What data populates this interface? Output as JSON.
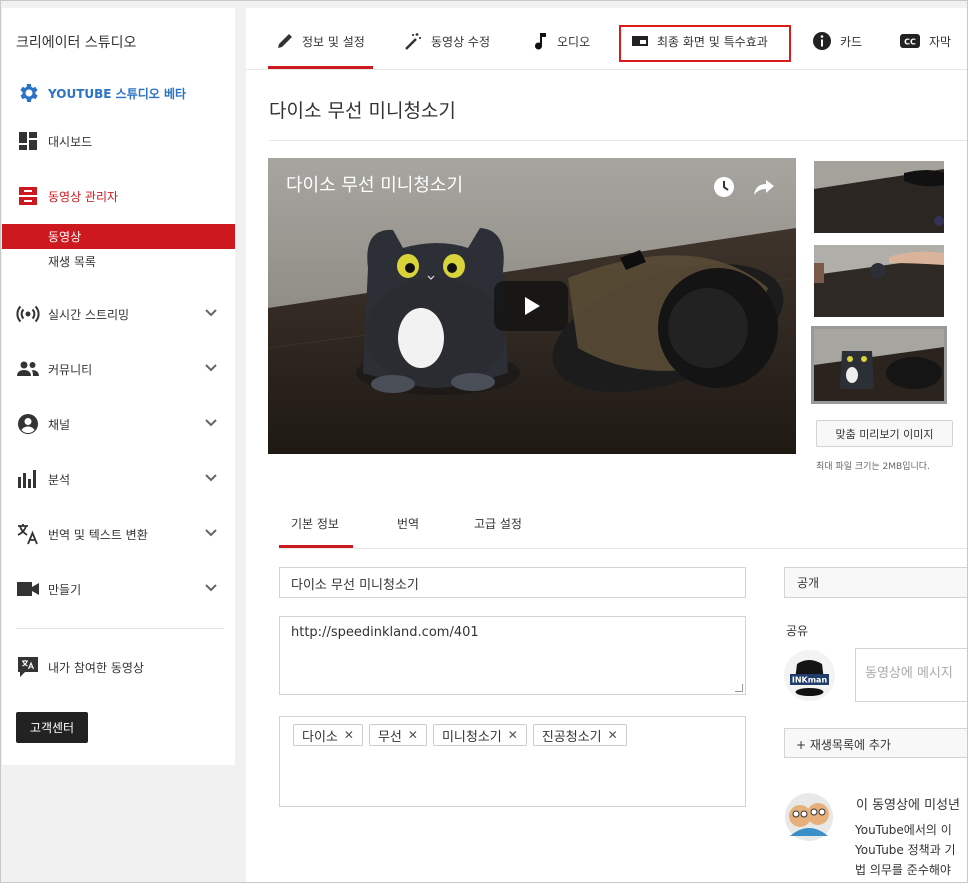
{
  "sidebar": {
    "title": "크리에이터 스튜디오",
    "studio_label": "YOUTUBE 스튜디오 베타",
    "items": [
      {
        "label": "대시보드"
      },
      {
        "label": "동영상 관리자"
      },
      {
        "label": "실시간 스트리밍"
      },
      {
        "label": "커뮤니티"
      },
      {
        "label": "채널"
      },
      {
        "label": "분석"
      },
      {
        "label": "번역 및 텍스트 변환"
      },
      {
        "label": "만들기"
      }
    ],
    "subitems": [
      {
        "label": "동영상",
        "active": true
      },
      {
        "label": "재생 목록",
        "active": false
      }
    ],
    "contributed_label": "내가 참여한 동영상",
    "help_button": "고객센터"
  },
  "tabs": [
    {
      "label": "정보 및 설정",
      "icon": "pencil-icon"
    },
    {
      "label": "동영상 수정",
      "icon": "magic-wand-icon"
    },
    {
      "label": "오디오",
      "icon": "music-note-icon"
    },
    {
      "label": "최종 화면 및 특수효과",
      "icon": "end-screen-icon"
    },
    {
      "label": "카드",
      "icon": "info-icon"
    },
    {
      "label": "자막",
      "icon": "cc-icon"
    }
  ],
  "video": {
    "title": "다이소 무선 미니청소기",
    "player_title": "다이소 무선 미니청소기",
    "custom_thumbnail_button": "맞춤 미리보기 이미지",
    "max_file_size": "최대 파일 크기는 2MB입니다."
  },
  "subtabs": [
    "기본 정보",
    "번역",
    "고급 설정"
  ],
  "form": {
    "title_value": "다이소 무선 미니청소기",
    "description_value": "http://speedinkland.com/401",
    "tags": [
      "다이소",
      "무선",
      "미니청소기",
      "진공청소기"
    ],
    "privacy": "공개",
    "share_label": "공유",
    "share_placeholder": "동영상에 메시지",
    "add_playlist": "+ 재생목록에 추가",
    "monetization_title": "이 동영상에 미성년",
    "monetization_lines": [
      "YouTube에서의 이",
      "YouTube 정책과 기",
      "법 의무를 준수해야"
    ]
  },
  "colors": {
    "accent": "#cc181e",
    "studio_blue": "#2a73c5"
  }
}
